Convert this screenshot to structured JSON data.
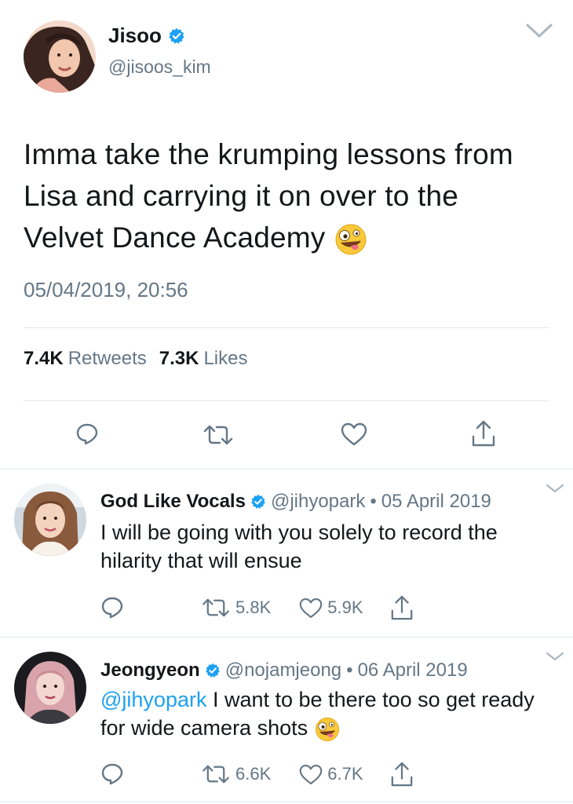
{
  "tweet": {
    "author_name": "Jisoo",
    "author_handle": "@jisoos_kim",
    "text": "Imma take the krumping lessons from Lisa and carrying it on over to the Velvet Dance Academy",
    "emoji": "zany-face-emoji",
    "timestamp": "05/04/2019, 20:56",
    "retweets_count": "7.4K",
    "retweets_label": "Retweets",
    "likes_count": "7.3K",
    "likes_label": "Likes"
  },
  "replies": [
    {
      "author_name": "God Like Vocals",
      "author_handle": "@jihyopark",
      "date": "05 April 2019",
      "mention": "",
      "text": "I will be going with you solely to record the hilarity that will ensue",
      "retweets": "5.8K",
      "likes": "5.9K"
    },
    {
      "author_name": "Jeongyeon",
      "author_handle": "@nojamjeong",
      "date": "06 April 2019",
      "mention": "@jihyopark",
      "text": "I want to be there too so get ready for wide camera shots",
      "retweets": "6.6K",
      "likes": "6.7K"
    }
  ],
  "separator": "•",
  "colors": {
    "verified": "#1da1f2",
    "muted": "#657786",
    "link": "#1da1f2",
    "divider": "#e1e8ed",
    "text": "#14171a"
  }
}
